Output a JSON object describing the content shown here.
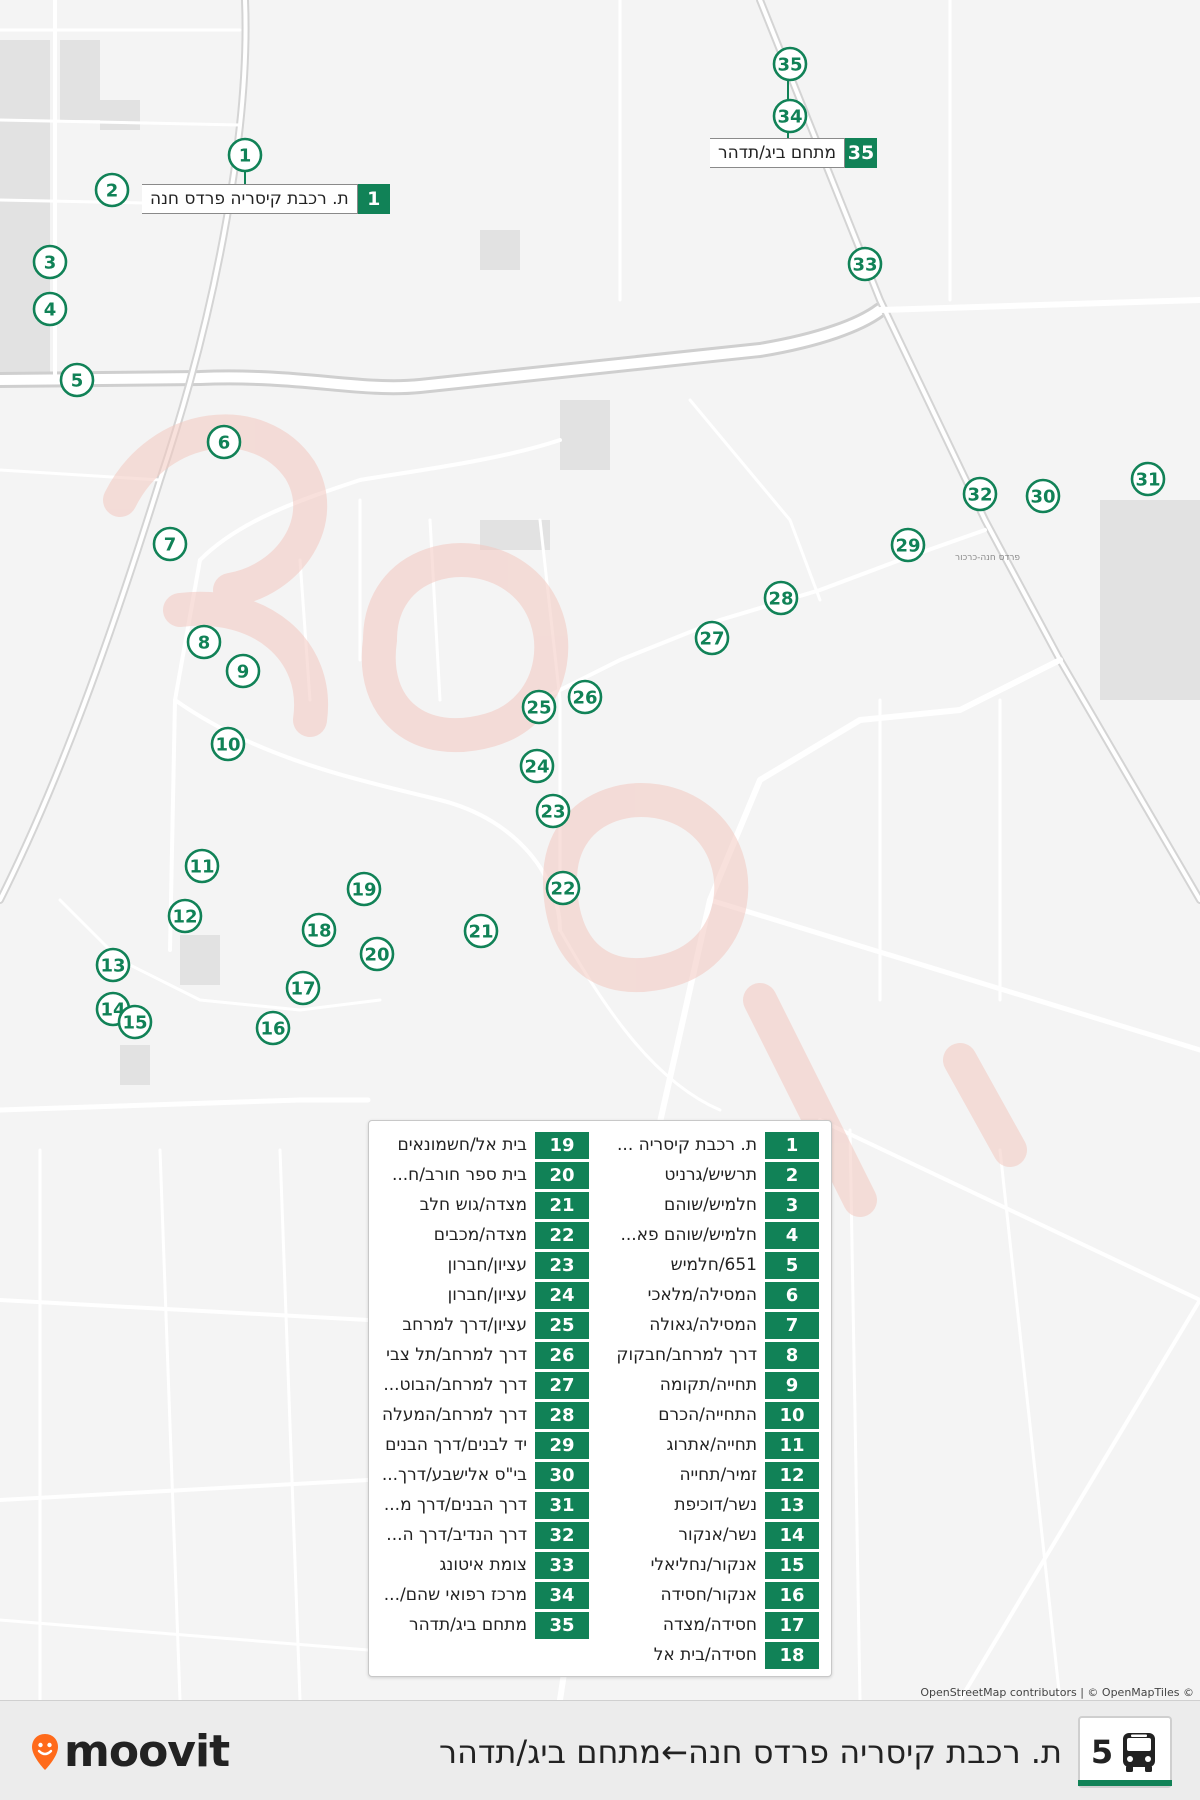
{
  "colors": {
    "route_green": "#118257",
    "background": "#f4f4f4",
    "road": "#ffffff",
    "watermark": "#f3c8c0",
    "logo_pin": "#ff6a1a"
  },
  "map": {
    "stops": [
      {
        "n": "1"
      },
      {
        "n": "2"
      },
      {
        "n": "3"
      },
      {
        "n": "4"
      },
      {
        "n": "5"
      },
      {
        "n": "6"
      },
      {
        "n": "7"
      },
      {
        "n": "8"
      },
      {
        "n": "9"
      },
      {
        "n": "10"
      },
      {
        "n": "11"
      },
      {
        "n": "12"
      },
      {
        "n": "13"
      },
      {
        "n": "14"
      },
      {
        "n": "15"
      },
      {
        "n": "16"
      },
      {
        "n": "17"
      },
      {
        "n": "18"
      },
      {
        "n": "19"
      },
      {
        "n": "20"
      },
      {
        "n": "21"
      },
      {
        "n": "22"
      },
      {
        "n": "23"
      },
      {
        "n": "24"
      },
      {
        "n": "25"
      },
      {
        "n": "26"
      },
      {
        "n": "27"
      },
      {
        "n": "28"
      },
      {
        "n": "29"
      },
      {
        "n": "30"
      },
      {
        "n": "31"
      },
      {
        "n": "32"
      },
      {
        "n": "33"
      },
      {
        "n": "34"
      },
      {
        "n": "35"
      }
    ],
    "callout_start": {
      "num": "1",
      "name": "ת. רכבת קיסריה פרדס חנה"
    },
    "callout_end": {
      "num": "35",
      "name": "מתחם ביג/תדהר"
    },
    "street_labels": [
      "פרדס חנה-כרכור"
    ]
  },
  "legend": {
    "right_column": [
      {
        "num": "1",
        "name": "ת. רכבת קיסריה ..."
      },
      {
        "num": "2",
        "name": "תרשיש/גרניט"
      },
      {
        "num": "3",
        "name": "חלמיש/שוהם"
      },
      {
        "num": "4",
        "name": "חלמיש/שוהם פא..."
      },
      {
        "num": "5",
        "name": "651/חלמיש"
      },
      {
        "num": "6",
        "name": "המסילה/מלאכי"
      },
      {
        "num": "7",
        "name": "המסילה/גאולה"
      },
      {
        "num": "8",
        "name": "דרך למרחב/חבקוק"
      },
      {
        "num": "9",
        "name": "תחייה/תקומה"
      },
      {
        "num": "10",
        "name": "התחייה/הכרם"
      },
      {
        "num": "11",
        "name": "תחייה/אתרוג"
      },
      {
        "num": "12",
        "name": "זמיר/תחייה"
      },
      {
        "num": "13",
        "name": "נשר/דוכיפת"
      },
      {
        "num": "14",
        "name": "נשר/אנקור"
      },
      {
        "num": "15",
        "name": "אנקור/נחליאלי"
      },
      {
        "num": "16",
        "name": "אנקור/חסידה"
      },
      {
        "num": "17",
        "name": "חסידה/מצדה"
      },
      {
        "num": "18",
        "name": "חסידה/בית אל"
      }
    ],
    "left_column": [
      {
        "num": "19",
        "name": "בית אל/חשמונאים"
      },
      {
        "num": "20",
        "name": "בית ספר חורב/ח..."
      },
      {
        "num": "21",
        "name": "מצדה/גוש חלב"
      },
      {
        "num": "22",
        "name": "מצדה/מכבים"
      },
      {
        "num": "23",
        "name": "עציון/חברון"
      },
      {
        "num": "24",
        "name": "עציון/חברון"
      },
      {
        "num": "25",
        "name": "עציון/דרך למרחב"
      },
      {
        "num": "26",
        "name": "דרך למרחב/תל צבי"
      },
      {
        "num": "27",
        "name": "דרך למרחב/הבוט..."
      },
      {
        "num": "28",
        "name": "דרך למרחב/המעלה"
      },
      {
        "num": "29",
        "name": "יד לבנים/דרך הבנים"
      },
      {
        "num": "30",
        "name": "בי\"ס אלישבע/דרך..."
      },
      {
        "num": "31",
        "name": "דרך הבנים/דרך מ..."
      },
      {
        "num": "32",
        "name": "דרך הנדיב/דרך ה..."
      },
      {
        "num": "33",
        "name": "צומת איטונג"
      },
      {
        "num": "34",
        "name": "מרכז רפואי שהם/..."
      },
      {
        "num": "35",
        "name": "מתחם ביג/תדהר"
      }
    ]
  },
  "attribution": "OpenStreetMap contributors | © OpenMapTiles ©",
  "footer": {
    "logo_text": "moovit",
    "route_number": "5",
    "bus_icon": "bus-icon",
    "route_title": "ת. רכבת קיסריה פרדס חנה←מתחם ביג/תדהר"
  }
}
